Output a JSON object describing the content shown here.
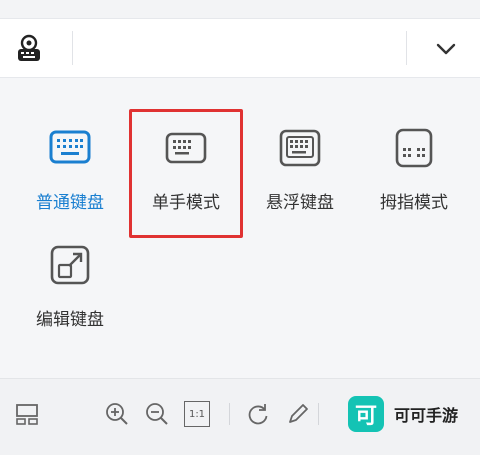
{
  "toolbar": {
    "settings_icon": "keyboard-settings-icon",
    "collapse_icon": "chevron-down-icon"
  },
  "modes": [
    {
      "label": "普通键盘",
      "icon": "keyboard-icon",
      "active": true
    },
    {
      "label": "单手模式",
      "icon": "one-hand-keyboard-icon",
      "active": false
    },
    {
      "label": "悬浮键盘",
      "icon": "floating-keyboard-icon",
      "active": false
    },
    {
      "label": "拇指模式",
      "icon": "thumb-keyboard-icon",
      "active": false
    },
    {
      "label": "编辑键盘",
      "icon": "edit-keyboard-icon",
      "active": false
    }
  ],
  "bottom_bar": {
    "icons": [
      "layout-icon",
      "zoom-in-icon",
      "zoom-out-icon",
      "actual-size-icon",
      "rotate-icon",
      "pen-icon"
    ],
    "actual_size_label": "1:1"
  },
  "watermark": {
    "logo_char": "可",
    "text": "可可手游"
  },
  "colors": {
    "accent": "#1a7fd0",
    "highlight": "#e03232",
    "watermark": "#14c3b4"
  }
}
